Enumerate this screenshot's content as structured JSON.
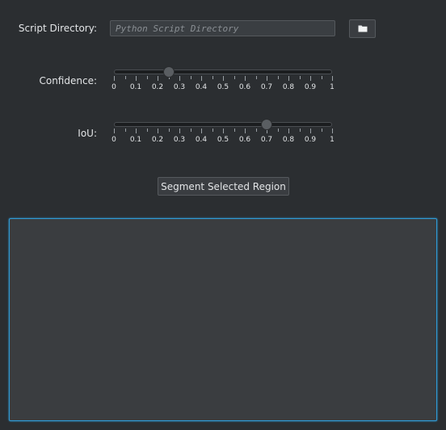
{
  "script_directory": {
    "label": "Script Directory:",
    "value": "",
    "placeholder": "Python Script Directory",
    "browse_icon": "folder-icon"
  },
  "confidence": {
    "label": "Confidence:",
    "value": 0.25,
    "min": 0,
    "max": 1,
    "tick_labels": [
      "0",
      "0.1",
      "0.2",
      "0.3",
      "0.4",
      "0.5",
      "0.6",
      "0.7",
      "0.8",
      "0.9",
      "1"
    ]
  },
  "iou": {
    "label": "IoU:",
    "value": 0.7,
    "min": 0,
    "max": 1,
    "tick_labels": [
      "0",
      "0.1",
      "0.2",
      "0.3",
      "0.4",
      "0.5",
      "0.6",
      "0.7",
      "0.8",
      "0.9",
      "1"
    ]
  },
  "segment_button": {
    "label": "Segment Selected Region"
  },
  "colors": {
    "background": "#2b2e31",
    "canvas_fill": "#3a3d40",
    "focus_border": "#2f9bd6"
  }
}
